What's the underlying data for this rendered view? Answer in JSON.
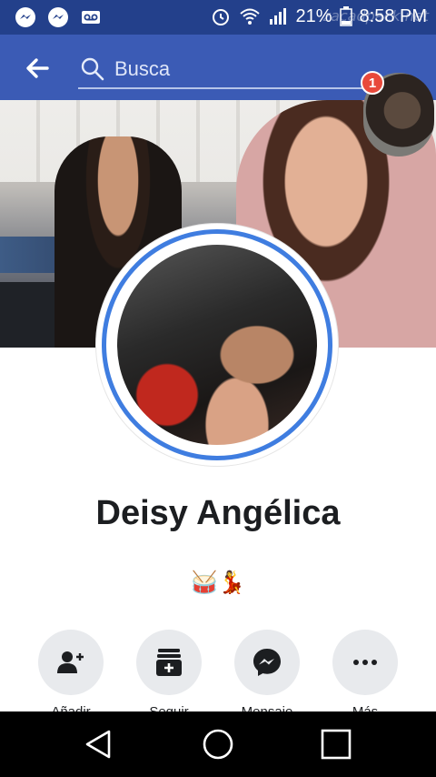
{
  "status_bar": {
    "battery_percent": "21%",
    "time": "8:58 PM",
    "watermark": "zacadpack.net",
    "notification_icons": [
      "messenger-icon",
      "messenger-icon",
      "voicemail-icon"
    ],
    "system_icons": [
      "alarm-icon",
      "wifi-icon",
      "signal-icon",
      "battery-icon"
    ]
  },
  "header": {
    "search_placeholder": "Busca",
    "notification_count": "1"
  },
  "profile": {
    "name": "Deisy Angélica",
    "emoji": "🥁💃"
  },
  "actions": [
    {
      "icon": "add-friend-icon",
      "label": "Añadir"
    },
    {
      "icon": "follow-icon",
      "label": "Seguir"
    },
    {
      "icon": "messenger-icon",
      "label": "Mensaje"
    },
    {
      "icon": "more-icon",
      "label": "Más"
    }
  ],
  "colors": {
    "status_bar": "#23408b",
    "top_bar": "#3b5bb5",
    "avatar_ring": "#3f7de0",
    "badge": "#e8493b"
  }
}
